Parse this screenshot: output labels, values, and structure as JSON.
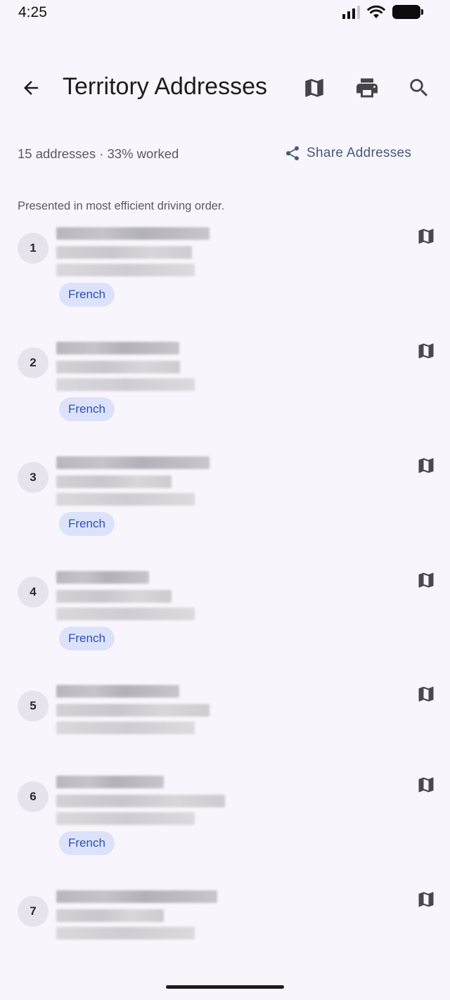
{
  "status_bar": {
    "time": "4:25",
    "icons": [
      "cellular-signal-icon",
      "wifi-icon",
      "battery-icon"
    ]
  },
  "app_bar": {
    "title": "Territory Addresses",
    "icons": {
      "back": "arrow-left-icon",
      "map": "map-icon",
      "print": "printer-icon",
      "search": "search-icon"
    }
  },
  "summary": {
    "text": "15 addresses · 33% worked",
    "share_label": "Share Addresses",
    "share_icon": "share-icon"
  },
  "hint": "Presented in most efficient driving order.",
  "addresses": [
    {
      "number": "1",
      "language": "French",
      "address_redacted": true
    },
    {
      "number": "2",
      "language": "French",
      "address_redacted": true
    },
    {
      "number": "3",
      "language": "French",
      "address_redacted": true
    },
    {
      "number": "4",
      "language": "French",
      "address_redacted": true
    },
    {
      "number": "5",
      "language": "",
      "address_redacted": true
    },
    {
      "number": "6",
      "language": "French",
      "address_redacted": true
    },
    {
      "number": "7",
      "language": "",
      "address_redacted": true
    }
  ],
  "colors": {
    "background": "#f8f6fc",
    "accent": "#455a7c",
    "chip_background": "#dce2f9",
    "chip_text": "#2c51b3",
    "badge_background": "#e6e3ec"
  }
}
